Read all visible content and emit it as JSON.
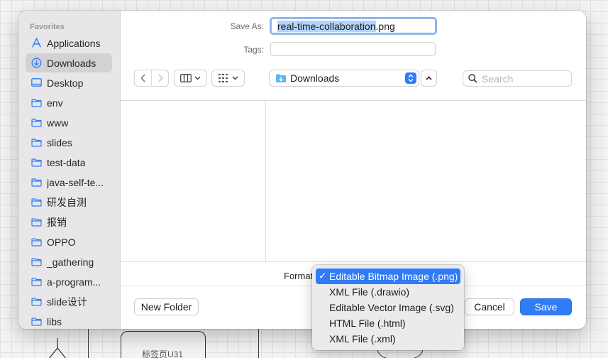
{
  "background": {
    "box_label": "标签页U31"
  },
  "sidebar": {
    "heading": "Favorites",
    "items": [
      {
        "label": "Applications",
        "icon": "applications-icon",
        "selected": false
      },
      {
        "label": "Downloads",
        "icon": "downloads-icon",
        "selected": true
      },
      {
        "label": "Desktop",
        "icon": "desktop-icon",
        "selected": false
      },
      {
        "label": "env",
        "icon": "folder-icon",
        "selected": false
      },
      {
        "label": "www",
        "icon": "folder-icon",
        "selected": false
      },
      {
        "label": "slides",
        "icon": "folder-icon",
        "selected": false
      },
      {
        "label": "test-data",
        "icon": "folder-icon",
        "selected": false
      },
      {
        "label": "java-self-te...",
        "icon": "folder-icon",
        "selected": false
      },
      {
        "label": "研发自测",
        "icon": "folder-icon",
        "selected": false
      },
      {
        "label": "报销",
        "icon": "folder-icon",
        "selected": false
      },
      {
        "label": "OPPO",
        "icon": "folder-icon",
        "selected": false
      },
      {
        "label": "_gathering",
        "icon": "folder-icon",
        "selected": false
      },
      {
        "label": "a-program...",
        "icon": "folder-icon",
        "selected": false
      },
      {
        "label": "slide设计",
        "icon": "folder-icon",
        "selected": false
      },
      {
        "label": "libs",
        "icon": "folder-icon",
        "selected": false
      }
    ]
  },
  "form": {
    "save_as_label": "Save As:",
    "filename_selected": "real-time-collaboration",
    "filename_rest": ".png",
    "tags_label": "Tags:",
    "tags_value": ""
  },
  "toolbar": {
    "location": "Downloads",
    "search_placeholder": "Search"
  },
  "format": {
    "label": "Format",
    "options": [
      {
        "label": "Editable Bitmap Image (.png)",
        "selected": true
      },
      {
        "label": "XML File (.drawio)",
        "selected": false
      },
      {
        "label": "Editable Vector Image (.svg)",
        "selected": false
      },
      {
        "label": "HTML File (.html)",
        "selected": false
      },
      {
        "label": "XML File (.xml)",
        "selected": false
      }
    ]
  },
  "buttons": {
    "new_folder": "New Folder",
    "cancel": "Cancel",
    "save": "Save"
  },
  "colors": {
    "accent": "#2f7cf6",
    "sidebar_bg": "#e8e6e9",
    "selection_highlight": "#b3d3fb"
  }
}
